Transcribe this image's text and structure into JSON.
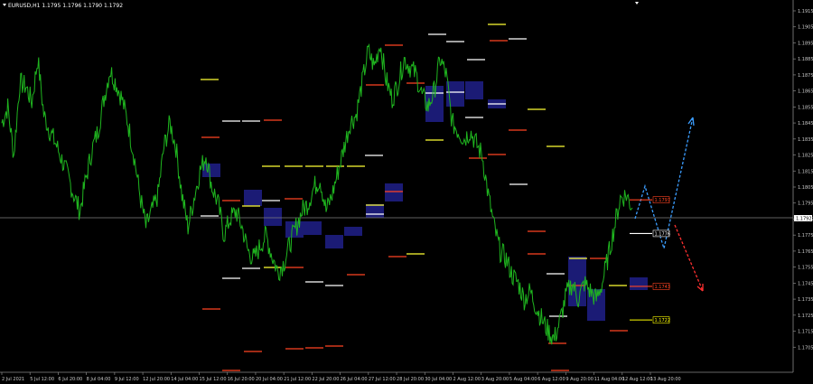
{
  "title": "EURUSD,H1  1.1795 1.1796 1.1790 1.1792",
  "chart_data": {
    "type": "line",
    "title": "EURUSD,H1  1.1795 1.1796 1.1790 1.1792",
    "ylim": [
      1.1695,
      1.1915
    ],
    "y_ticks": [
      "1.1915",
      "1.1905",
      "1.1895",
      "1.1885",
      "1.1875",
      "1.1865",
      "1.1855",
      "1.1845",
      "1.1835",
      "1.1825",
      "1.1815",
      "1.1805",
      "1.1795",
      "1.1785",
      "1.1775",
      "1.1765",
      "1.1755",
      "1.1745",
      "1.1735",
      "1.1725",
      "1.1715",
      "1.1705"
    ],
    "x_ticks": [
      "2 Jul 2021",
      "5 Jul 12:00",
      "6 Jul 20:00",
      "8 Jul 04:00",
      "9 Jul 12:00",
      "12 Jul 20:00",
      "14 Jul 04:00",
      "15 Jul 12:00",
      "16 Jul 20:00",
      "20 Jul 04:00",
      "21 Jul 12:00",
      "22 Jul 20:00",
      "26 Jul 04:00",
      "27 Jul 12:00",
      "28 Jul 20:00",
      "30 Jul 04:00",
      "2 Aug 12:00",
      "3 Aug 20:00",
      "5 Aug 04:00",
      "6 Aug 12:00",
      "9 Aug 20:00",
      "11 Aug 04:00",
      "12 Aug 12:00",
      "13 Aug 20:00"
    ],
    "price_keypoints": [
      [
        0,
        1.1845
      ],
      [
        2,
        1.1855
      ],
      [
        4,
        1.1825
      ],
      [
        6,
        1.187
      ],
      [
        8,
        1.1868
      ],
      [
        10,
        1.1858
      ],
      [
        12,
        1.1885
      ],
      [
        14,
        1.185
      ],
      [
        16,
        1.184
      ],
      [
        18,
        1.1832
      ],
      [
        20,
        1.1822
      ],
      [
        22,
        1.1812
      ],
      [
        24,
        1.18
      ],
      [
        26,
        1.179
      ],
      [
        28,
        1.181
      ],
      [
        30,
        1.1828
      ],
      [
        32,
        1.184
      ],
      [
        34,
        1.186
      ],
      [
        36,
        1.1878
      ],
      [
        38,
        1.187
      ],
      [
        40,
        1.186
      ],
      [
        42,
        1.1845
      ],
      [
        44,
        1.1825
      ],
      [
        46,
        1.18
      ],
      [
        48,
        1.178
      ],
      [
        50,
        1.179
      ],
      [
        52,
        1.18
      ],
      [
        54,
        1.183
      ],
      [
        56,
        1.1845
      ],
      [
        58,
        1.183
      ],
      [
        60,
        1.18
      ],
      [
        62,
        1.178
      ],
      [
        64,
        1.1798
      ],
      [
        66,
        1.1815
      ],
      [
        68,
        1.1825
      ],
      [
        70,
        1.1805
      ],
      [
        72,
        1.1795
      ],
      [
        74,
        1.1775
      ],
      [
        76,
        1.1785
      ],
      [
        78,
        1.179
      ],
      [
        80,
        1.178
      ],
      [
        82,
        1.1765
      ],
      [
        84,
        1.176
      ],
      [
        86,
        1.1768
      ],
      [
        88,
        1.1775
      ],
      [
        90,
        1.1762
      ],
      [
        92,
        1.1752
      ],
      [
        94,
        1.1758
      ],
      [
        96,
        1.177
      ],
      [
        98,
        1.178
      ],
      [
        100,
        1.179
      ],
      [
        102,
        1.1795
      ],
      [
        104,
        1.1805
      ],
      [
        106,
        1.181
      ],
      [
        108,
        1.179
      ],
      [
        110,
        1.18
      ],
      [
        112,
        1.1815
      ],
      [
        114,
        1.183
      ],
      [
        116,
        1.1845
      ],
      [
        118,
        1.185
      ],
      [
        120,
        1.187
      ],
      [
        122,
        1.189
      ],
      [
        124,
        1.188
      ],
      [
        126,
        1.1895
      ],
      [
        128,
        1.1872
      ],
      [
        130,
        1.186
      ],
      [
        132,
        1.187
      ],
      [
        134,
        1.1885
      ],
      [
        136,
        1.188
      ],
      [
        138,
        1.1875
      ],
      [
        140,
        1.1862
      ],
      [
        142,
        1.1855
      ],
      [
        144,
        1.1865
      ],
      [
        146,
        1.1885
      ],
      [
        148,
        1.1875
      ],
      [
        150,
        1.1845
      ],
      [
        152,
        1.184
      ],
      [
        154,
        1.1835
      ],
      [
        156,
        1.184
      ],
      [
        158,
        1.1832
      ],
      [
        160,
        1.1825
      ],
      [
        162,
        1.18
      ],
      [
        164,
        1.178
      ],
      [
        166,
        1.1765
      ],
      [
        168,
        1.176
      ],
      [
        170,
        1.175
      ],
      [
        172,
        1.1745
      ],
      [
        174,
        1.1735
      ],
      [
        176,
        1.174
      ],
      [
        178,
        1.173
      ],
      [
        180,
        1.1722
      ],
      [
        182,
        1.1715
      ],
      [
        184,
        1.171
      ],
      [
        186,
        1.1722
      ],
      [
        188,
        1.1738
      ],
      [
        190,
        1.1745
      ],
      [
        192,
        1.1735
      ],
      [
        194,
        1.1745
      ],
      [
        196,
        1.174
      ],
      [
        198,
        1.1735
      ],
      [
        200,
        1.1745
      ],
      [
        202,
        1.1762
      ],
      [
        204,
        1.178
      ],
      [
        206,
        1.1798
      ],
      [
        208,
        1.18
      ],
      [
        210,
        1.1792
      ]
    ],
    "current_price": "1.1792",
    "price_tags": [
      {
        "label": "1.1797",
        "value": 1.1797,
        "color": "#ff4422"
      },
      {
        "label": "1.1776",
        "value": 1.1776,
        "color": "#ffffff"
      },
      {
        "label": "1.1743",
        "value": 1.1743,
        "color": "#ff4422"
      },
      {
        "label": "1.1722",
        "value": 1.1722,
        "color": "#ffff00"
      }
    ],
    "level_colors": {
      "orange": "#ff4422",
      "yellow": "#ffff33",
      "white": "#ffffff",
      "zone": "#20208a",
      "price": "#1fb51f",
      "forecast_up": "#3b9dff",
      "forecast_down": "#ff3030"
    }
  },
  "meta_icons": {
    "dropdown": "triangle-down-icon"
  }
}
